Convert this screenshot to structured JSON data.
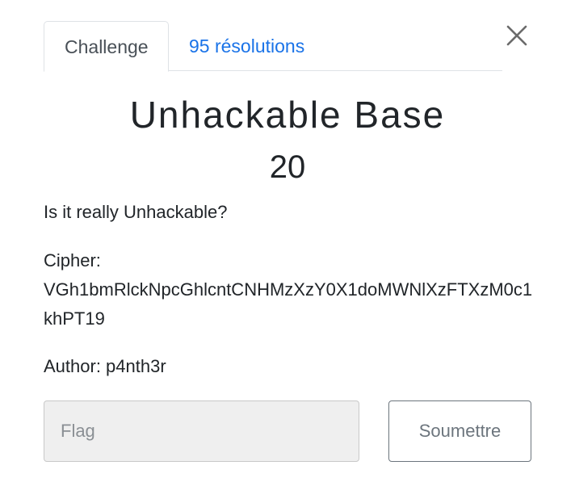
{
  "tabs": {
    "challenge_label": "Challenge",
    "solves_label": "95 résolutions"
  },
  "challenge": {
    "name": "Unhackable Base",
    "points": "20",
    "description_line1": "Is it really Unhackable?",
    "cipher_label": "Cipher:",
    "cipher_value": "VGh1bmRlckNpcGhlcntCNHMzXzY0X1doMWNlXzFTXzM0c1khPT19",
    "author": "Author: p4nth3r"
  },
  "form": {
    "flag_placeholder": "Flag",
    "flag_value": "",
    "submit_label": "Soumettre"
  },
  "icons": {
    "close": "close-icon"
  },
  "colors": {
    "link": "#1a73e8",
    "text": "#212529",
    "muted": "#6c757d",
    "input_bg": "#efefef"
  }
}
